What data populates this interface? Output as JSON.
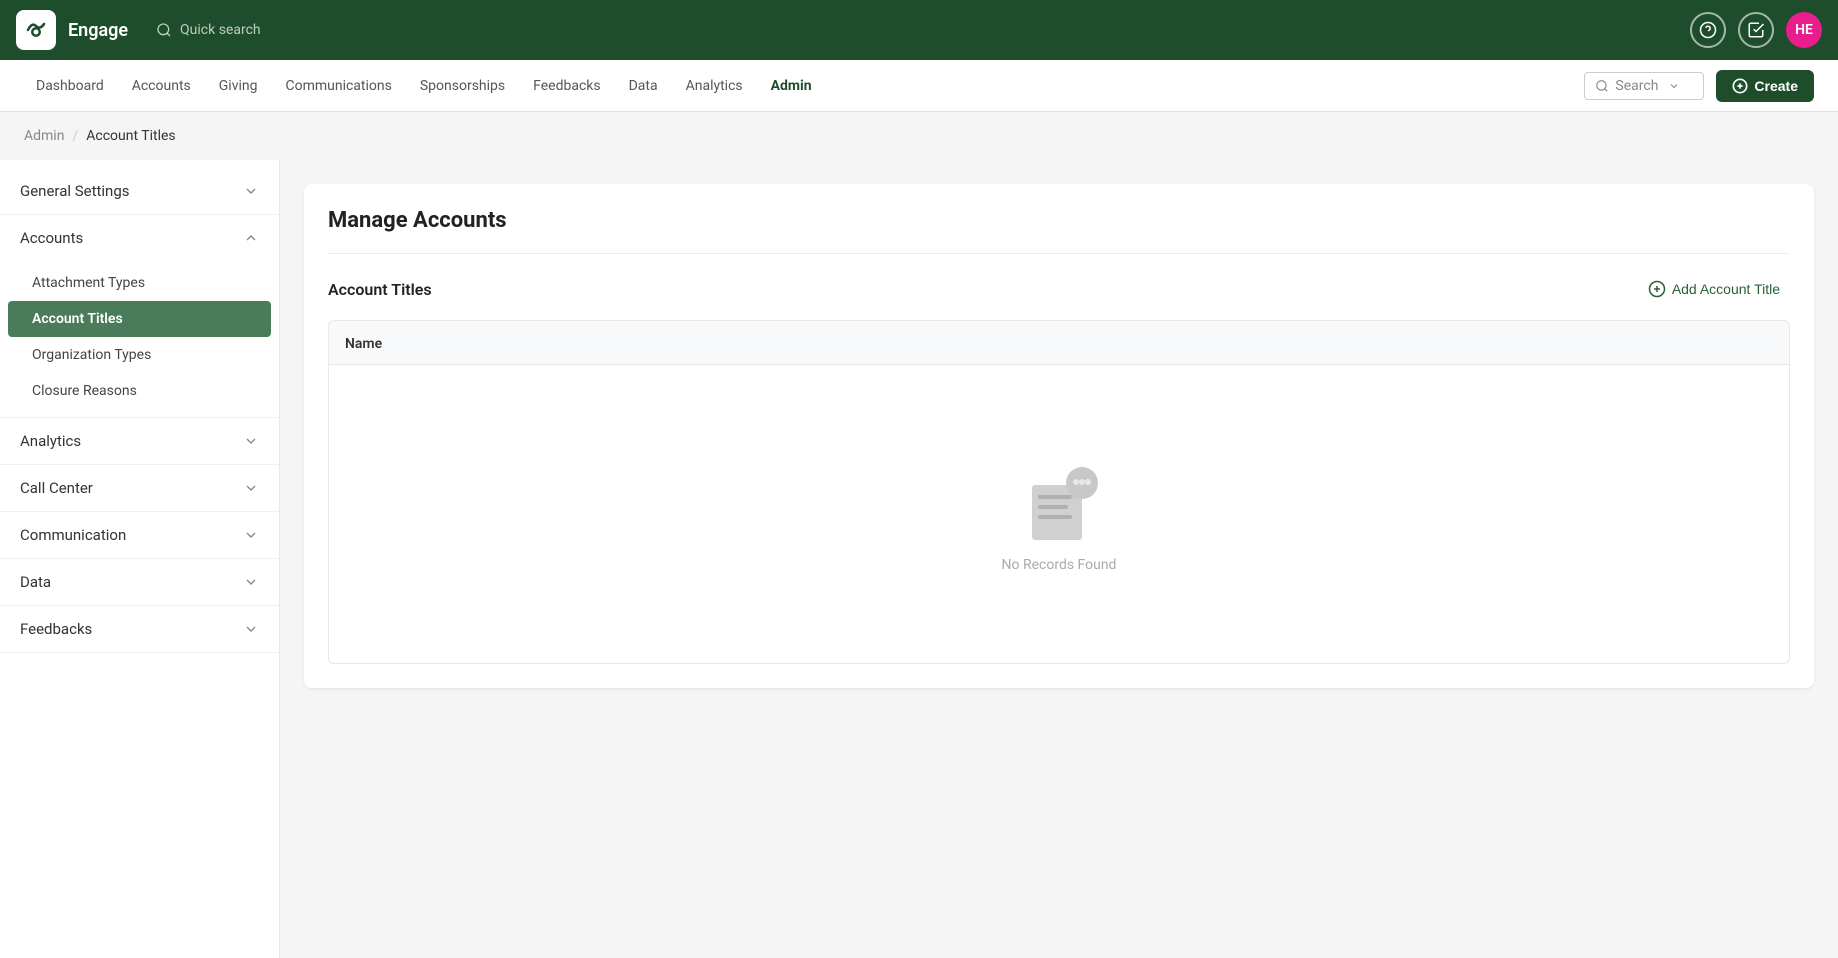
{
  "app": {
    "name": "Engage",
    "logo_alt": "engage-logo"
  },
  "topbar": {
    "quick_search": "Quick search",
    "help_icon": "help-icon",
    "tasks_icon": "tasks-icon",
    "avatar_initials": "HE"
  },
  "navbar": {
    "items": [
      {
        "label": "Dashboard",
        "active": false
      },
      {
        "label": "Accounts",
        "active": false
      },
      {
        "label": "Giving",
        "active": false
      },
      {
        "label": "Communications",
        "active": false
      },
      {
        "label": "Sponsorships",
        "active": false
      },
      {
        "label": "Feedbacks",
        "active": false
      },
      {
        "label": "Data",
        "active": false
      },
      {
        "label": "Analytics",
        "active": false
      },
      {
        "label": "Admin",
        "active": true
      }
    ],
    "search_placeholder": "Search",
    "create_label": "Create"
  },
  "breadcrumb": {
    "parent": "Admin",
    "current": "Account Titles"
  },
  "sidebar": {
    "sections": [
      {
        "label": "General Settings",
        "expanded": false,
        "items": []
      },
      {
        "label": "Accounts",
        "expanded": true,
        "items": [
          {
            "label": "Attachment Types",
            "active": false
          },
          {
            "label": "Account Titles",
            "active": true
          },
          {
            "label": "Organization Types",
            "active": false
          },
          {
            "label": "Closure Reasons",
            "active": false
          }
        ]
      },
      {
        "label": "Analytics",
        "expanded": false,
        "items": []
      },
      {
        "label": "Call Center",
        "expanded": false,
        "items": []
      },
      {
        "label": "Communication",
        "expanded": false,
        "items": []
      },
      {
        "label": "Data",
        "expanded": false,
        "items": []
      },
      {
        "label": "Feedbacks",
        "expanded": false,
        "items": []
      }
    ]
  },
  "content": {
    "page_title": "Manage Accounts",
    "section_title": "Account Titles",
    "add_button": "Add Account Title",
    "table": {
      "columns": [
        "Name"
      ],
      "empty_text": "No Records Found"
    }
  }
}
